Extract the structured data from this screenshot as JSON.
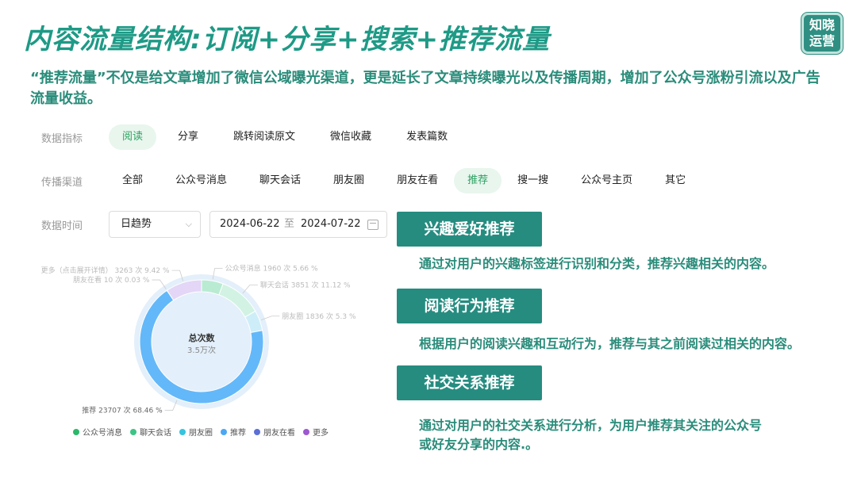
{
  "title": "内容流量结构:订阅+分享+搜索+推荐流量",
  "logo": {
    "line1": "知晓",
    "line2": "运营"
  },
  "subtitle": "“推荐流量”不仅是给文章增加了微信公域曝光渠道，更是延长了文章持续曝光以及传播周期，增加了公众号涨粉引流以及广告流量收益。",
  "filters": {
    "metric_label": "数据指标",
    "metrics": [
      "阅读",
      "分享",
      "跳转阅读原文",
      "微信收藏",
      "发表篇数"
    ],
    "metric_selected": "阅读",
    "channel_label": "传播渠道",
    "channels": [
      "全部",
      "公众号消息",
      "聊天会话",
      "朋友圈",
      "朋友在看",
      "推荐",
      "搜一搜",
      "公众号主页",
      "其它"
    ],
    "channel_selected": "推荐",
    "time_label": "数据时间",
    "time_mode": "日趋势",
    "date_start": "2024-06-22",
    "date_sep": "至",
    "date_end": "2024-07-22"
  },
  "chart_data": {
    "type": "pie",
    "center_title": "总次数",
    "center_value": "3.5万次",
    "series": [
      {
        "name": "公众号消息",
        "value": 1960,
        "percent": 5.66,
        "color": "#b9ebd2",
        "label": "公众号消息 1960 次 5.66 %"
      },
      {
        "name": "聊天会话",
        "value": 3851,
        "percent": 11.12,
        "color": "#d2f2e4",
        "label": "聊天会话 3851 次 11.12 %"
      },
      {
        "name": "朋友圈",
        "value": 1836,
        "percent": 5.3,
        "color": "#cdeef8",
        "label": "朋友圈 1836 次 5.3 %"
      },
      {
        "name": "推荐",
        "value": 23707,
        "percent": 68.46,
        "color": "#63b8f9",
        "label": "推荐 23707 次 68.46 %"
      },
      {
        "name": "朋友在看",
        "value": 10,
        "percent": 0.03,
        "color": "#c3c8f2",
        "label": "朋友在看 10 次 0.03 %"
      },
      {
        "name": "更多（点击展开详情）",
        "value": 3263,
        "percent": 9.42,
        "color": "#e3d6f6",
        "label": "更多（点击展开详情） 3263 次 9.42 %"
      }
    ],
    "legend": [
      {
        "name": "公众号消息",
        "color": "#2cb86a"
      },
      {
        "name": "聊天会话",
        "color": "#3cc487"
      },
      {
        "name": "朋友圈",
        "color": "#36c4de"
      },
      {
        "name": "推荐",
        "color": "#4ba7f3"
      },
      {
        "name": "朋友在看",
        "color": "#5b6fd6"
      },
      {
        "name": "更多",
        "color": "#9c59d0"
      }
    ]
  },
  "sections": [
    {
      "title": "兴趣爱好推荐",
      "desc": [
        "通过对用户的兴趣标签进行识别和分类，推荐兴趣相关的内容。"
      ]
    },
    {
      "title": "阅读行为推荐",
      "desc": [
        "根据用户的阅读兴趣和互动行为，推荐与其之前阅读过相关的内容。"
      ]
    },
    {
      "title": "社交关系推荐",
      "desc": [
        "通过对用户的社交关系进行分析，为用户推荐其关注的公众号",
        "或好友分享的内容.。"
      ]
    }
  ],
  "colors": {
    "accent": "#1e9a86",
    "section_bg": "#268c80",
    "chip_active_bg": "#e8f6ee",
    "chip_active_text": "#2da160"
  }
}
